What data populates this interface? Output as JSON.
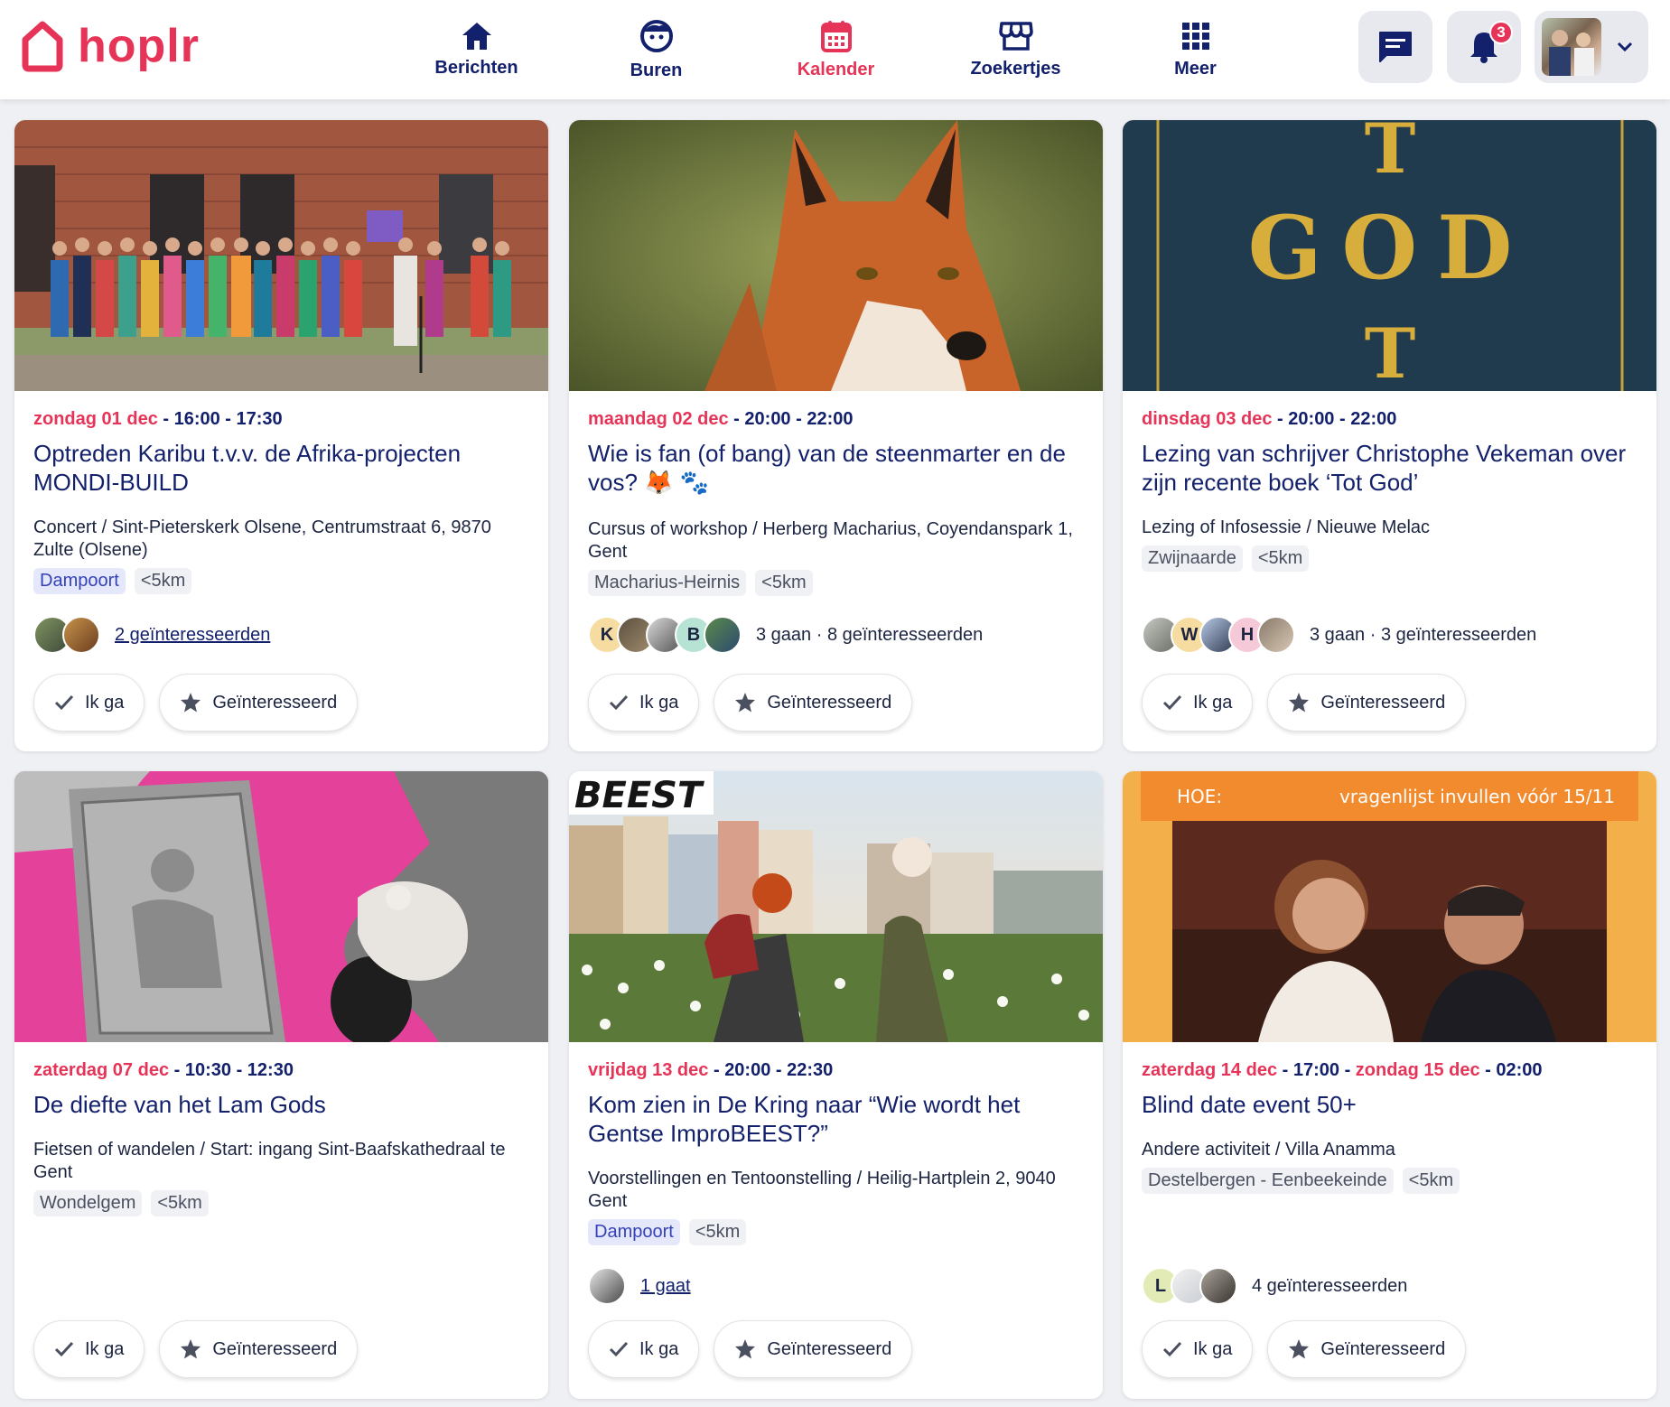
{
  "brand": {
    "name": "hoplr",
    "color": "#e63458"
  },
  "nav": [
    {
      "label": "Berichten",
      "icon": "home-icon"
    },
    {
      "label": "Buren",
      "icon": "neighbour-face-icon"
    },
    {
      "label": "Kalender",
      "icon": "calendar-icon",
      "active": true
    },
    {
      "label": "Zoekertjes",
      "icon": "shop-icon"
    },
    {
      "label": "Meer",
      "icon": "grid-icon"
    }
  ],
  "header_actions": {
    "notifications_count": "3"
  },
  "buttons": {
    "going": "Ik ga",
    "interested": "Geïnteresseerd"
  },
  "events": [
    {
      "date": "zondag 01 dec",
      "time": "16:00 - 17:30",
      "title": "Optreden Karibu t.v.v. de Afrika-projecten MONDI-BUILD",
      "subtitle": "Concert / Sint-Pieterskerk Olsene, Centrumstraat 6, 9870 Zulte (Olsene)",
      "tags": [
        "Dampoort",
        "<5km"
      ],
      "attendance": "2 geïnteresseerden"
    },
    {
      "date": "maandag 02 dec",
      "time": "20:00 - 22:00",
      "title": "Wie is fan (of bang) van de steenmarter en de vos? 🦊 🐾",
      "subtitle": "Cursus of workshop / Herberg Macharius, Coyendanspark 1, Gent",
      "tags": [
        "Macharius-Heirnis",
        "<5km"
      ],
      "attendance": "3 gaan · 8 geïnteresseerden",
      "avatar_letters": [
        "K",
        "",
        "",
        "B",
        ""
      ]
    },
    {
      "date": "dinsdag 03 dec",
      "time": "20:00 - 22:00",
      "title": "Lezing van schrijver Christophe Vekeman over zijn recente boek ‘Tot God’",
      "subtitle": "Lezing of Infosessie / Nieuwe Melac",
      "tags": [
        "Zwijnaarde",
        "<5km"
      ],
      "attendance": "3 gaan · 3 geïnteresseerden",
      "avatar_letters": [
        "",
        "W",
        "",
        "H",
        ""
      ],
      "image_text": {
        "top": "T",
        "mid": "GOD",
        "bottom": "T"
      }
    },
    {
      "date": "zaterdag 07 dec",
      "time": "10:30 - 12:30",
      "title": "De diefte van het Lam Gods",
      "subtitle": "Fietsen of wandelen / Start: ingang Sint-Baafskathedraal te Gent",
      "tags": [
        "Wondelgem",
        "<5km"
      ]
    },
    {
      "date": "vrijdag 13 dec",
      "time": "20:00 - 22:30",
      "title": "Kom zien in De Kring naar “Wie wordt het Gentse ImproBEEST?”",
      "subtitle": "Voorstellingen en Tentoonstelling / Heilig-Hartplein 2, 9040 Gent",
      "tags": [
        "Dampoort",
        "<5km"
      ],
      "attendance": "1 gaat",
      "image_text": {
        "logo": "BEEST"
      }
    },
    {
      "date": "zaterdag 14 dec",
      "time": "17:00",
      "end_date": "zondag 15 dec",
      "end_time": "02:00",
      "title": "Blind date event 50+",
      "subtitle": "Andere activiteit / Villa Anamma",
      "tags": [
        "Destelbergen - Eenbeekeinde",
        "<5km"
      ],
      "attendance": "4 geïnteresseerden",
      "avatar_letters": [
        "L",
        "",
        ""
      ],
      "image_text": {
        "label": "HOE:",
        "value": "vragenlijst invullen vóór 15/11"
      }
    }
  ]
}
